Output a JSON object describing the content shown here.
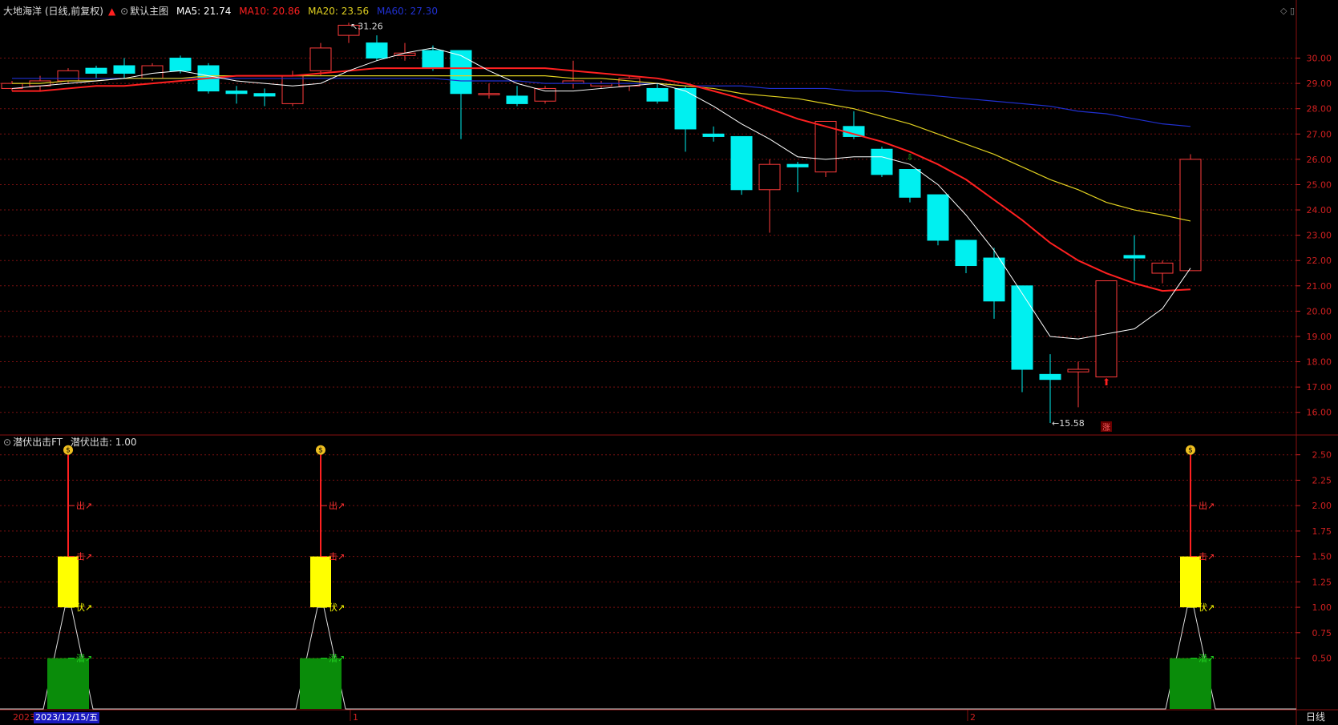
{
  "header": {
    "stock": "大地海洋 (日线,前复权)",
    "template": "默认主图",
    "ma5_label": "MA5: 21.74",
    "ma10_label": "MA10: 20.86",
    "ma20_label": "MA20: 23.56",
    "ma60_label": "MA60: 27.30",
    "indicator_title": "潜伏出击FT",
    "indicator_value": "潜伏出击: 1.00"
  },
  "colors": {
    "up": "#ff3b3b",
    "down": "#00f0f0",
    "ma5": "#ffffff",
    "ma10": "#ff2020",
    "ma20": "#e0d020",
    "ma60": "#2030d0",
    "grid": "#7a1010",
    "axis_text": "#d02020",
    "bar_yellow": "#ffff00",
    "bar_green": "#0a8c0a"
  },
  "footer": {
    "year": "2023",
    "date": "2023/12/15/五",
    "month1": "1",
    "month2": "2",
    "period": "日线"
  },
  "chart_data": [
    {
      "type": "candlestick",
      "name": "main",
      "ylim": [
        15.2,
        31.6
      ],
      "y_ticks": [
        16.0,
        17.0,
        18.0,
        19.0,
        20.0,
        21.0,
        22.0,
        23.0,
        24.0,
        25.0,
        26.0,
        27.0,
        28.0,
        29.0,
        30.0
      ],
      "candles": [
        [
          28.8,
          29.0,
          28.7,
          29.1
        ],
        [
          28.9,
          29.1,
          28.7,
          29.3
        ],
        [
          29.1,
          29.5,
          29.0,
          29.6
        ],
        [
          29.6,
          29.4,
          29.2,
          29.7
        ],
        [
          29.7,
          29.4,
          29.2,
          30.0
        ],
        [
          29.2,
          29.7,
          29.1,
          29.8
        ],
        [
          30.0,
          29.5,
          29.4,
          30.1
        ],
        [
          29.7,
          28.7,
          28.6,
          29.8
        ],
        [
          28.7,
          28.6,
          28.2,
          28.9
        ],
        [
          28.6,
          28.5,
          28.1,
          28.8
        ],
        [
          28.2,
          29.3,
          28.1,
          29.5
        ],
        [
          29.5,
          30.4,
          29.3,
          30.6
        ],
        [
          30.9,
          31.3,
          30.6,
          31.4
        ],
        [
          30.6,
          30.0,
          29.9,
          30.9
        ],
        [
          30.1,
          30.2,
          29.9,
          30.6
        ],
        [
          30.3,
          29.6,
          29.5,
          30.5
        ],
        [
          30.3,
          28.6,
          26.8,
          30.3
        ],
        [
          28.6,
          28.6,
          28.4,
          29.0
        ],
        [
          28.5,
          28.2,
          28.1,
          28.9
        ],
        [
          28.3,
          28.8,
          28.2,
          28.9
        ],
        [
          29.0,
          29.1,
          28.8,
          29.9
        ],
        [
          28.9,
          29.0,
          28.8,
          29.1
        ],
        [
          28.9,
          29.2,
          28.7,
          29.3
        ],
        [
          28.8,
          28.3,
          28.2,
          29.0
        ],
        [
          28.8,
          27.2,
          26.3,
          28.9
        ],
        [
          27.0,
          26.9,
          26.7,
          27.3
        ],
        [
          26.9,
          24.8,
          24.6,
          26.9
        ],
        [
          24.8,
          25.8,
          23.1,
          26.0
        ],
        [
          25.8,
          25.7,
          24.7,
          25.9
        ],
        [
          25.5,
          27.5,
          25.3,
          27.5
        ],
        [
          27.3,
          26.9,
          26.8,
          27.9
        ],
        [
          26.4,
          25.4,
          25.3,
          26.5
        ],
        [
          25.6,
          24.5,
          24.3,
          25.6
        ],
        [
          24.6,
          22.8,
          22.6,
          24.6
        ],
        [
          22.8,
          21.8,
          21.5,
          22.8
        ],
        [
          22.1,
          20.4,
          19.7,
          22.5
        ],
        [
          21.0,
          17.7,
          16.8,
          21.0
        ],
        [
          17.5,
          17.3,
          15.58,
          18.3
        ],
        [
          17.6,
          17.7,
          16.2,
          18.0
        ],
        [
          17.4,
          21.2,
          17.4,
          21.2
        ],
        [
          22.2,
          22.1,
          21.2,
          23.0
        ],
        [
          21.5,
          21.9,
          21.1,
          22.0
        ],
        [
          21.6,
          26.0,
          21.6,
          26.2
        ]
      ],
      "ma5": [
        28.8,
        28.9,
        29.0,
        29.1,
        29.2,
        29.4,
        29.5,
        29.3,
        29.1,
        29.0,
        28.9,
        29.0,
        29.5,
        29.9,
        30.2,
        30.4,
        30.1,
        29.5,
        29.0,
        28.7,
        28.7,
        28.8,
        28.9,
        29.0,
        28.7,
        28.1,
        27.4,
        26.8,
        26.1,
        26.0,
        26.1,
        26.1,
        25.8,
        25.0,
        23.8,
        22.4,
        20.7,
        19.0,
        18.9,
        19.1,
        19.3,
        20.1,
        21.7
      ],
      "ma10": [
        28.7,
        28.7,
        28.8,
        28.9,
        28.9,
        29.0,
        29.1,
        29.2,
        29.3,
        29.3,
        29.3,
        29.4,
        29.5,
        29.6,
        29.6,
        29.6,
        29.6,
        29.6,
        29.6,
        29.6,
        29.5,
        29.4,
        29.3,
        29.2,
        29.0,
        28.7,
        28.4,
        28.0,
        27.6,
        27.3,
        27.0,
        26.7,
        26.3,
        25.8,
        25.2,
        24.4,
        23.6,
        22.7,
        22.0,
        21.5,
        21.1,
        20.8,
        20.86
      ],
      "ma20": [
        29.0,
        29.0,
        29.1,
        29.1,
        29.2,
        29.2,
        29.2,
        29.3,
        29.3,
        29.3,
        29.3,
        29.3,
        29.3,
        29.3,
        29.3,
        29.3,
        29.3,
        29.3,
        29.3,
        29.3,
        29.2,
        29.2,
        29.1,
        29.0,
        28.9,
        28.8,
        28.6,
        28.5,
        28.4,
        28.2,
        28.0,
        27.7,
        27.4,
        27.0,
        26.6,
        26.2,
        25.7,
        25.2,
        24.8,
        24.3,
        24.0,
        23.8,
        23.56
      ],
      "ma60": [
        29.2,
        29.2,
        29.2,
        29.2,
        29.2,
        29.2,
        29.2,
        29.2,
        29.2,
        29.2,
        29.2,
        29.2,
        29.2,
        29.2,
        29.2,
        29.2,
        29.1,
        29.1,
        29.1,
        29.0,
        29.0,
        29.0,
        29.0,
        29.0,
        28.9,
        28.9,
        28.9,
        28.8,
        28.8,
        28.8,
        28.7,
        28.7,
        28.6,
        28.5,
        28.4,
        28.3,
        28.2,
        28.1,
        27.9,
        27.8,
        27.6,
        27.4,
        27.3
      ],
      "annotations": {
        "high_label": "31.26",
        "low_label": "15.58",
        "zhang": "涨"
      }
    },
    {
      "type": "bar",
      "name": "潜伏出击",
      "ylim": [
        0,
        2.6
      ],
      "y_ticks": [
        "0.50",
        "0.75",
        "1.00",
        "1.25",
        "1.50",
        "1.75",
        "2.00",
        "2.25",
        "2.50"
      ],
      "signal_index": [
        2,
        11,
        42
      ],
      "green_value": 0.5,
      "yellow_value": [
        1.0,
        1.5
      ],
      "red_line_to": 2.5,
      "tags": [
        "潜↗",
        "伏↗",
        "击↗",
        "出↗"
      ]
    }
  ]
}
